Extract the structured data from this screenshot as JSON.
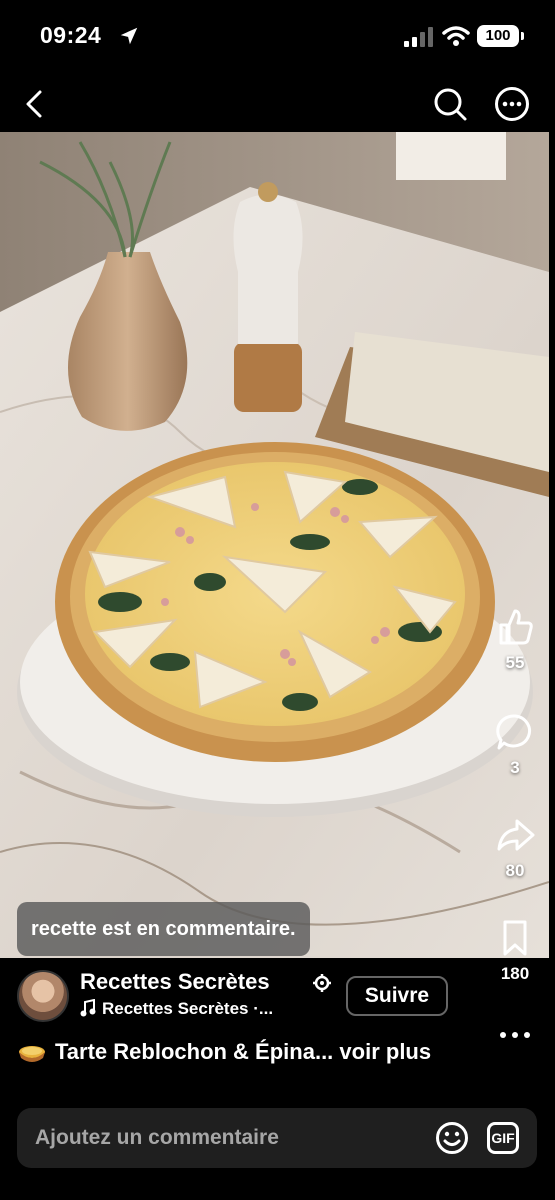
{
  "status_bar": {
    "time": "09:24",
    "battery": "100"
  },
  "nav": {
    "back_icon": "chevron-left-icon",
    "search_icon": "search-icon",
    "more_icon": "more-circle-icon"
  },
  "actions": {
    "likes": "55",
    "comments": "3",
    "shares": "80",
    "saves": "180"
  },
  "caption_overlay": "recette est en commentaire.",
  "author": {
    "name": "Recettes Secrètes",
    "music": "Recettes Secrètes ·...",
    "follow_label": "Suivre"
  },
  "post": {
    "title": "Tarte Reblochon & Épina...",
    "see_more": "voir plus"
  },
  "comment_bar": {
    "placeholder": "Ajoutez un commentaire",
    "gif_label": "GIF"
  },
  "colors": {
    "background": "#000000",
    "input_bg": "#1f1f1f",
    "placeholder": "#a6a6a6"
  }
}
